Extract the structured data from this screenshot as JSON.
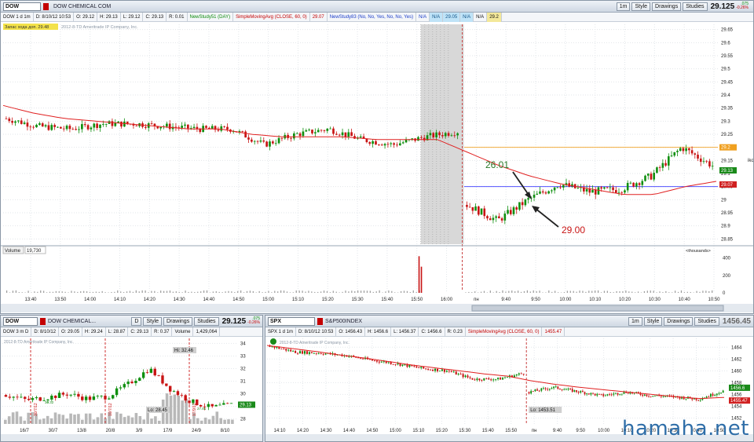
{
  "main": {
    "symbol": "DOW",
    "description": "DOW CHEMICAL COM",
    "tb_1m": "1m",
    "tb_style": "Style",
    "tb_drawings": "Drawings",
    "tb_studies": "Studies",
    "price": "29.125",
    "change_up": ".075",
    "change_dn": "-0.26%",
    "info": {
      "period": "DOW 1 d 1m",
      "date": "D: 8/10/12 10:53",
      "open": "O: 29.12",
      "high": "H: 29.13",
      "low": "L: 29.12",
      "close": "C: 29.13",
      "range": "R: 0.01",
      "study1": "NewStudy51 (DAY)",
      "sma": "SimpleMovingAvg (CLOSE, 60, 0)",
      "sma_val": "29.07",
      "study2": "NewStudy83 (No, No, Yes, No, No, Yes)",
      "na1": "N/A",
      "na2": "N/A",
      "v1": "29.05",
      "na3": "N/A",
      "na4": "N/A",
      "v2": "29.2"
    },
    "yellow_label": "Запас хода доп. 29.48",
    "watermark": "2012-8-TD Ameritrade IP Company, Inc.",
    "annotation1": "26.01",
    "annotation2": "29.00",
    "right_edge_label": "iko",
    "volume_label": "Volume",
    "volume_value": "19,730",
    "volume_units": "<thousands>",
    "yaxis_labels": [
      "29.65",
      "29.6",
      "29.55",
      "29.5",
      "29.45",
      "29.4",
      "29.35",
      "29.3",
      "29.25",
      "29.2",
      "29.15",
      "29.1",
      "29.05",
      "29",
      "28.95",
      "28.9",
      "28.85"
    ],
    "price_tags": [
      {
        "text": "29.2",
        "color": "#f0a020"
      },
      {
        "text": "29.13",
        "color": "#1a8a1a"
      },
      {
        "text": "29.07",
        "color": "#d02020"
      }
    ],
    "volume_ticks": [
      "400",
      "200",
      "0"
    ],
    "xaxis_labels": [
      "13:40",
      "13:50",
      "14:00",
      "14:10",
      "14:20",
      "14:30",
      "14:40",
      "14:50",
      "15:00",
      "15:10",
      "15:20",
      "15:30",
      "15:40",
      "15:50",
      "16:00",
      "пн",
      "9:40",
      "9:50",
      "10:00",
      "10:10",
      "10:20",
      "10:30",
      "10:40",
      "10:50"
    ]
  },
  "left": {
    "symbol": "DOW",
    "description": "DOW CHEMICAL...",
    "tb_d": "D",
    "tb_style": "Style",
    "tb_drawings": "Drawings",
    "tb_studies": "Studies",
    "price": "29.125",
    "change_up": ".075",
    "change_dn": "-0.26%",
    "info": {
      "period": "DOW 3 m D",
      "date": "D: 8/10/12",
      "open": "O: 29.05",
      "high": "H: 29.24",
      "low": "L: 28.87",
      "close": "C: 29.13",
      "range": "R: 0.37",
      "volume": "Volume",
      "volume_val": "1,429,064"
    },
    "watermark": "2012-8-TD Ameritrade IP Company, Inc.",
    "hi_label": "Hi: 32.46",
    "lo_label": "Lo: 28.45",
    "vert_label_1": "30/7/12",
    "vert_label_2": "10/7/12",
    "vert_label_3": "17/9/12",
    "small_label": "30.32",
    "small_label_2": "27.81",
    "price_tag": "29.13",
    "yaxis_labels": [
      "34",
      "33",
      "32",
      "31",
      "30",
      "29",
      "28"
    ],
    "xaxis_labels": [
      "16/7",
      "30/7",
      "13/8",
      "20/8",
      "3/9",
      "17/9",
      "24/9",
      "8/10"
    ]
  },
  "right": {
    "symbol": "SPX",
    "description": "S&P500INDEX",
    "tb_1m": "1m",
    "tb_style": "Style",
    "tb_drawings": "Drawings",
    "tb_studies": "Studies",
    "price": "1456.45",
    "info": {
      "period": "SPX 1 d 1m",
      "date": "D: 8/10/12 10:53",
      "open": "O: 1456.43",
      "high": "H: 1456.6",
      "low": "L: 1456.37",
      "close": "C: 1456.6",
      "range": "R: 0.23",
      "sma": "SimpleMovingAvg (CLOSE, 60, 0)",
      "sma_val": "1455.47"
    },
    "watermark": "2012-8-TD Ameritrade IP Company, Inc.",
    "lo_label": "Lo: 1453.51",
    "price_tags": [
      {
        "text": "1456.6",
        "color": "#1a8a1a"
      },
      {
        "text": "1455.47",
        "color": "#d02020"
      }
    ],
    "yaxis_labels": [
      "1464",
      "1462",
      "1460",
      "1458",
      "1456",
      "1454",
      "1452"
    ],
    "xaxis_labels": [
      "14:10",
      "14:20",
      "14:30",
      "14:40",
      "14:50",
      "15:00",
      "15:10",
      "15:20",
      "15:30",
      "15:40",
      "15:50",
      "пн",
      "9:40",
      "9:50",
      "10:00",
      "10:10",
      "10:20",
      "10:30",
      "10:40",
      "10:50"
    ]
  },
  "site_watermark": "hamaha.net",
  "chart_data": [
    {
      "type": "line",
      "title": "DOW 1 d 1m",
      "ylim": [
        28.83,
        29.67
      ],
      "x": [
        "13:40",
        "13:50",
        "14:00",
        "14:10",
        "14:20",
        "14:30",
        "14:40",
        "14:50",
        "15:00",
        "15:10",
        "15:20",
        "15:30",
        "15:40",
        "15:50",
        "16:00",
        "пн",
        "9:40",
        "9:50",
        "10:00",
        "10:10",
        "10:20",
        "10:30",
        "10:40",
        "10:50"
      ],
      "series": [
        {
          "name": "Close",
          "values": [
            29.31,
            29.28,
            29.27,
            29.29,
            29.29,
            29.28,
            29.27,
            29.27,
            29.21,
            29.25,
            29.27,
            29.23,
            29.21,
            29.24,
            29.26,
            28.98,
            28.92,
            29.0,
            29.06,
            29.03,
            29.04,
            29.09,
            29.2,
            29.13
          ]
        },
        {
          "name": "SimpleMovingAvg (CLOSE, 60, 0)",
          "values": [
            29.36,
            29.33,
            29.31,
            29.3,
            29.29,
            29.28,
            29.27,
            29.27,
            29.25,
            29.24,
            29.24,
            29.24,
            29.23,
            29.23,
            29.23,
            29.18,
            29.13,
            29.09,
            29.06,
            29.04,
            29.02,
            29.02,
            29.05,
            29.07
          ]
        }
      ],
      "levels": [
        29.2,
        29.05
      ],
      "volume": {
        "ylim": [
          0,
          450
        ],
        "spike_values": [
          420,
          300
        ]
      }
    },
    {
      "type": "line",
      "title": "DOW 3 m D",
      "ylim": [
        27.6,
        34.4
      ],
      "x": [
        "16/7",
        "30/7",
        "13/8",
        "20/8",
        "3/9",
        "17/9",
        "24/9",
        "8/10"
      ],
      "series": [
        {
          "name": "Close",
          "values": [
            29.9,
            29.5,
            29.7,
            30.0,
            29.6,
            29.8,
            30.8,
            32.0,
            30.4,
            29.4,
            28.9,
            29.13
          ]
        }
      ]
    },
    {
      "type": "line",
      "title": "SPX 1 d 1m",
      "ylim": [
        1451,
        1465.5
      ],
      "x": [
        "14:10",
        "14:20",
        "14:30",
        "14:40",
        "14:50",
        "15:00",
        "15:10",
        "15:20",
        "15:30",
        "15:40",
        "15:50",
        "пн",
        "9:40",
        "9:50",
        "10:00",
        "10:10",
        "10:20",
        "10:30",
        "10:40",
        "10:50"
      ],
      "series": [
        {
          "name": "Close",
          "values": [
            1464.2,
            1463.2,
            1463.0,
            1462.6,
            1461.8,
            1461.2,
            1460.4,
            1460.0,
            1458.6,
            1458.6,
            1459.6,
            1456.4,
            1457.2,
            1456.5,
            1455.8,
            1456.4,
            1455.8,
            1455.6,
            1455.2,
            1456.6
          ]
        },
        {
          "name": "SimpleMovingAvg (CLOSE, 60, 0)",
          "values": [
            1464.3,
            1463.8,
            1463.3,
            1462.7,
            1462.2,
            1461.6,
            1461.0,
            1460.5,
            1460.0,
            1459.5,
            1459.1,
            1458.3,
            1457.7,
            1457.2,
            1456.8,
            1456.4,
            1456.0,
            1455.6,
            1455.3,
            1455.5
          ]
        }
      ]
    }
  ]
}
